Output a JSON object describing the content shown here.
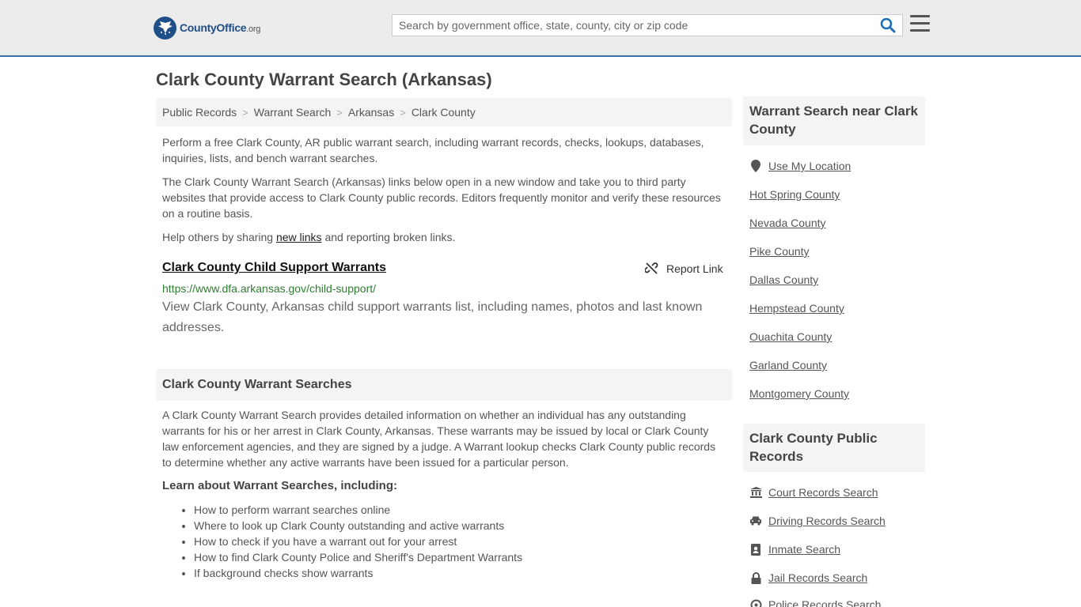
{
  "header": {
    "logo_brand": "CountyOffice",
    "logo_tld": ".org",
    "search_placeholder": "Search by government office, state, county, city or zip code"
  },
  "page_title": "Clark County Warrant Search (Arkansas)",
  "breadcrumb": [
    "Public Records",
    "Warrant Search",
    "Arkansas",
    "Clark County"
  ],
  "intro": {
    "p1": "Perform a free Clark County, AR public warrant search, including warrant records, checks, lookups, databases, inquiries, lists, and bench warrant searches.",
    "p2": "The Clark County Warrant Search (Arkansas) links below open in a new window and take you to third party websites that provide access to Clark County public records. Editors frequently monitor and verify these resources on a routine basis.",
    "p3_before": "Help others by sharing ",
    "p3_link": "new links",
    "p3_after": " and reporting broken links."
  },
  "result": {
    "title": "Clark County Child Support Warrants",
    "report_label": "Report Link",
    "url": "https://www.dfa.arkansas.gov/child-support/",
    "description": "View Clark County, Arkansas child support warrants list, including names, photos and last known addresses."
  },
  "searches_section": {
    "heading": "Clark County Warrant Searches",
    "text": "A Clark County Warrant Search provides detailed information on whether an individual has any outstanding warrants for his or her arrest in Clark County, Arkansas. These warrants may be issued by local or Clark County law enforcement agencies, and they are signed by a judge. A Warrant lookup checks Clark County public records to determine whether any active warrants have been issued for a particular person.",
    "learn_heading": "Learn about Warrant Searches, including:",
    "learn_items": [
      "How to perform warrant searches online",
      "Where to look up Clark County outstanding and active warrants",
      "How to check if you have a warrant out for your arrest",
      "How to find Clark County Police and Sheriff's Department Warrants",
      "If background checks show warrants"
    ]
  },
  "sidebar": {
    "nearby_heading": "Warrant Search near Clark County",
    "nearby_links": [
      "Use My Location",
      "Hot Spring County",
      "Nevada County",
      "Pike County",
      "Dallas County",
      "Hempstead County",
      "Ouachita County",
      "Garland County",
      "Montgomery County"
    ],
    "records_heading": "Clark County Public Records",
    "records_links": [
      "Court Records Search",
      "Driving Records Search",
      "Inmate Search",
      "Jail Records Search",
      "Police Records Search"
    ]
  },
  "colors": {
    "header_bg": "#ececec",
    "header_border": "#3a6fa8",
    "brand_blue": "#1f4f86",
    "search_icon": "#1f6fb8",
    "url_green": "#2e7d32",
    "panel_bg": "#f4f4f4"
  }
}
